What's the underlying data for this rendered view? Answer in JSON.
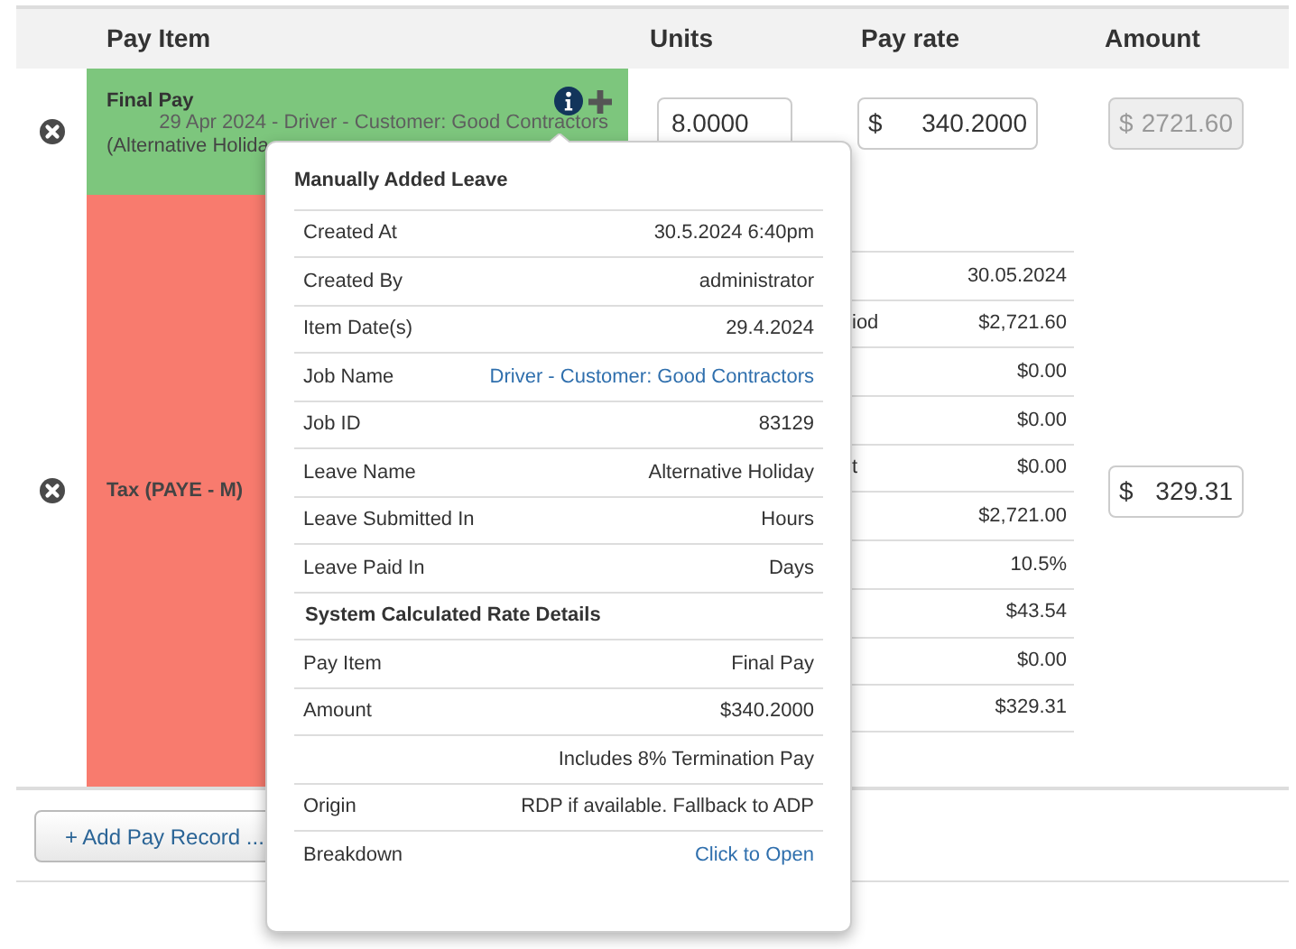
{
  "table": {
    "columns": [
      "Pay Item",
      "Units",
      "Pay rate",
      "Amount"
    ],
    "rows": [
      {
        "kind": "earning",
        "pay_item": "Final Pay",
        "detail_line_1": "29 Apr 2024 - Driver - Customer: Good Contractors",
        "detail_line_2": "(Alternative Holida",
        "units": "8.0000",
        "rate_currency": "$",
        "pay_rate": "340.2000",
        "amount_currency": "$",
        "amount": "2721.60",
        "amount_disabled": true
      },
      {
        "kind": "deduction",
        "pay_item": "Tax (PAYE - M)",
        "breakdown": [
          {
            "value": "30.05.2024"
          },
          {
            "label": "iod",
            "value": "$2,721.60"
          },
          {
            "value": "$0.00"
          },
          {
            "value": "$0.00"
          },
          {
            "label": "t",
            "value": "$0.00"
          },
          {
            "value": "$2,721.00"
          },
          {
            "value": "10.5%"
          },
          {
            "value": "$43.54"
          },
          {
            "value": "$0.00"
          },
          {
            "value": "$329.31"
          }
        ],
        "amount_currency": "$",
        "amount": "329.31",
        "amount_disabled": false
      }
    ]
  },
  "add_button": "+ Add Pay Record ...",
  "popover": {
    "title": "Manually Added Leave",
    "rows": [
      {
        "kind": "field",
        "label": "Created At",
        "value": "30.5.2024 6:40pm"
      },
      {
        "kind": "field",
        "label": "Created By",
        "value": "administrator"
      },
      {
        "kind": "field",
        "label": "Item Date(s)",
        "value": "29.4.2024"
      },
      {
        "kind": "link",
        "label": "Job Name",
        "value": "Driver - Customer: Good Contractors"
      },
      {
        "kind": "field",
        "label": "Job ID",
        "value": "83129"
      },
      {
        "kind": "field",
        "label": "Leave Name",
        "value": "Alternative Holiday"
      },
      {
        "kind": "field",
        "label": "Leave Submitted In",
        "value": "Hours"
      },
      {
        "kind": "field",
        "label": "Leave Paid In",
        "value": "Days"
      },
      {
        "kind": "heading",
        "label": "System Calculated Rate Details"
      },
      {
        "kind": "field",
        "label": "Pay Item",
        "value": "Final Pay"
      },
      {
        "kind": "field",
        "label": "Amount",
        "value": "$340.2000"
      },
      {
        "kind": "note",
        "value": "Includes 8% Termination Pay"
      },
      {
        "kind": "field",
        "label": "Origin",
        "value": "RDP if available. Fallback to ADP"
      },
      {
        "kind": "link",
        "label": "Breakdown",
        "value": "Click to Open"
      }
    ]
  }
}
